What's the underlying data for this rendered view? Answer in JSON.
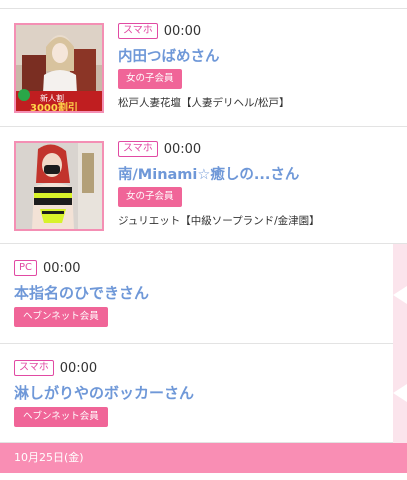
{
  "entries": [
    {
      "device": "スマホ",
      "time": "00:00",
      "name": "内田つばめさん",
      "badge": "女の子会員",
      "shop": "松戸人妻花壇【人妻デリヘル/松戸】",
      "thumb_text_1": "新人割",
      "thumb_text_2": "3000割引"
    },
    {
      "device": "スマホ",
      "time": "00:00",
      "name": "南/Minami☆癒しの...さん",
      "badge": "女の子会員",
      "shop": "ジュリエット【中級ソープランド/金津園】"
    },
    {
      "device": "PC",
      "time": "00:00",
      "name": "本指名のひできさん",
      "badge": "ヘブンネット会員"
    },
    {
      "device": "スマホ",
      "time": "00:00",
      "name": "淋しがりやのボッカーさん",
      "badge": "ヘブンネット会員"
    }
  ],
  "date_header": "10月25日(金)",
  "colors": {
    "accent_pink": "#f06598",
    "device_magenta": "#e14aa3",
    "name_blue": "#6f98d8",
    "date_bar": "#f98eb4"
  }
}
